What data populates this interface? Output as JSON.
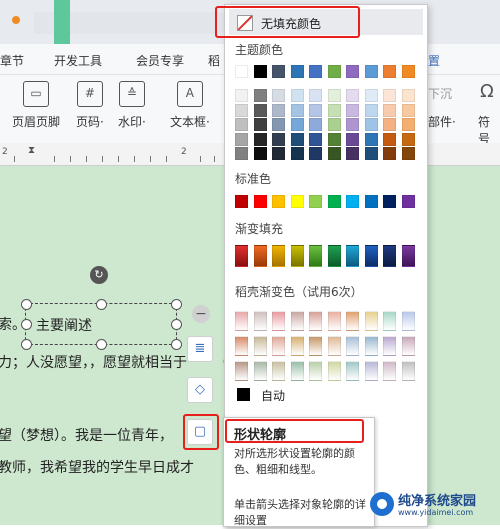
{
  "menu": {
    "items": [
      "章节",
      "开发工具",
      "会员专享",
      "稻"
    ]
  },
  "toolbar": {
    "items": [
      {
        "label": "页眉页脚",
        "icon": "header-footer-icon"
      },
      {
        "label": "页码·",
        "icon": "page-number-icon"
      },
      {
        "label": "水印·",
        "icon": "watermark-icon"
      },
      {
        "label": "文本框·",
        "icon": "textbox-icon"
      }
    ],
    "right_labels": {
      "setting": "置",
      "sink": "下沉",
      "parts": "部件·",
      "symbol": "符号"
    }
  },
  "ruler": {
    "numbers": [
      "2",
      "2"
    ]
  },
  "doc": {
    "textbox_text": "主要阐述",
    "line1_prefix": "索。",
    "line2": "力；人没愿望，，愿望就相当于",
    "line3": "望（梦想）。我是一位青年，",
    "line4": "教师，我希望我的学生早日成才",
    "line2_suffix": "（"
  },
  "dropdown": {
    "no_fill": "无填充颜色",
    "theme_colors_label": "主题颜色",
    "standard_colors_label": "标准色",
    "gradient_fill_label": "渐变填充",
    "shell_gradient_label": "稻壳渐变色（试用6次）",
    "auto_label": "自动",
    "theme_top_row": [
      "#ffffff",
      "#000000",
      "#44546a",
      "#2e75b6",
      "#4472c4",
      "#70ad47",
      "#8e6bbf",
      "#5b9bd5",
      "#ed7d31",
      "#f08a24"
    ],
    "theme_shades": [
      [
        "#f2f2f2",
        "#7f7f7f",
        "#d6dce4",
        "#d0e2f2",
        "#d9e2f3",
        "#e2efda",
        "#e4dbef",
        "#deebf7",
        "#fbe5d6",
        "#fce4cf"
      ],
      [
        "#d9d9d9",
        "#595959",
        "#adb9ca",
        "#a3c4e5",
        "#b4c6e7",
        "#c6e0b4",
        "#c9b8df",
        "#bdd7ee",
        "#f8cbad",
        "#f8c99f"
      ],
      [
        "#bfbfbf",
        "#3f3f3f",
        "#8497b0",
        "#75a7d9",
        "#8eaadb",
        "#a9d08e",
        "#ae95cf",
        "#9dc3e6",
        "#f4b183",
        "#f4ae6f"
      ],
      [
        "#a6a6a6",
        "#262626",
        "#333f50",
        "#1f4e79",
        "#2f5597",
        "#548235",
        "#6a4a95",
        "#2e75b6",
        "#c55a11",
        "#c56a12"
      ],
      [
        "#808080",
        "#0d0d0d",
        "#222a35",
        "#14344f",
        "#203864",
        "#375623",
        "#473163",
        "#1f4e79",
        "#843c0b",
        "#83470c"
      ]
    ],
    "standard_colors": [
      "#c00000",
      "#ff0000",
      "#ffc000",
      "#ffff00",
      "#92d050",
      "#00b050",
      "#00b0f0",
      "#0070c0",
      "#002060",
      "#7030a0"
    ],
    "gradient_colors": [
      [
        "#e03030",
        "#8a0f0f"
      ],
      [
        "#f06a20",
        "#9a3a08"
      ],
      [
        "#f0b400",
        "#a67400"
      ],
      [
        "#c8c000",
        "#7a7400"
      ],
      [
        "#6cc040",
        "#2f7a16"
      ],
      [
        "#20a050",
        "#0c5c2a"
      ],
      [
        "#20a8d8",
        "#0c5a80"
      ],
      [
        "#2060c0",
        "#0c2c6a"
      ],
      [
        "#203a80",
        "#0a1a40"
      ],
      [
        "#7a3aa0",
        "#3e1458"
      ]
    ],
    "shell_rows": [
      [
        "#e8a8a8",
        "#d0c0c0",
        "#e89ca0",
        "#c8a8a0",
        "#d8a098",
        "#e8b0a0",
        "#e0a070",
        "#e8d090",
        "#a8d8c8",
        "#b8c8e8"
      ],
      [
        "#d88a68",
        "#c8b898",
        "#e0a898",
        "#d8b070",
        "#c89868",
        "#e0b898",
        "#a8c0d8",
        "#98b8d0",
        "#b8a8d0",
        "#c8a8b8"
      ],
      [
        "#b89888",
        "#a8b8a8",
        "#c8c0a0",
        "#98c0a8",
        "#b8d0a8",
        "#d0d8a0",
        "#a0c8c8",
        "#b8b8d8",
        "#d0b8c8",
        "#c0c0c0"
      ]
    ],
    "auto_color": "#000000"
  },
  "tooltip": {
    "title": "形状轮廓",
    "body": "对所选形状设置轮廓的颜色、粗细和线型。",
    "footer": "单击箭头选择对象轮廓的详细设置"
  },
  "watermark": {
    "title": "纯净系统家园",
    "url": "www.yidaimei.com"
  }
}
